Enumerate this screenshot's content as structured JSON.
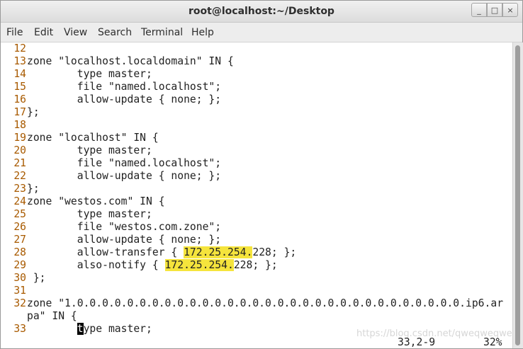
{
  "window": {
    "title": "root@localhost:~/Desktop"
  },
  "window_controls": [
    "_",
    "□",
    "×"
  ],
  "menu": [
    "File",
    "Edit",
    "View",
    "Search",
    "Terminal",
    "Help"
  ],
  "lines": [
    {
      "num": "12",
      "parts": []
    },
    {
      "num": "13",
      "parts": [
        {
          "t": "zone \"localhost.localdomain\" IN {"
        }
      ]
    },
    {
      "num": "14",
      "parts": [
        {
          "t": "        type master;"
        }
      ]
    },
    {
      "num": "15",
      "parts": [
        {
          "t": "        file \"named.localhost\";"
        }
      ]
    },
    {
      "num": "16",
      "parts": [
        {
          "t": "        allow-update { none; };"
        }
      ]
    },
    {
      "num": "17",
      "parts": [
        {
          "t": "};"
        }
      ]
    },
    {
      "num": "18",
      "parts": []
    },
    {
      "num": "19",
      "parts": [
        {
          "t": "zone \"localhost\" IN {"
        }
      ]
    },
    {
      "num": "20",
      "parts": [
        {
          "t": "        type master;"
        }
      ]
    },
    {
      "num": "21",
      "parts": [
        {
          "t": "        file \"named.localhost\";"
        }
      ]
    },
    {
      "num": "22",
      "parts": [
        {
          "t": "        allow-update { none; };"
        }
      ]
    },
    {
      "num": "23",
      "parts": [
        {
          "t": "};"
        }
      ]
    },
    {
      "num": "24",
      "parts": [
        {
          "t": "zone \"westos.com\" IN {"
        }
      ]
    },
    {
      "num": "25",
      "parts": [
        {
          "t": "        type master;"
        }
      ]
    },
    {
      "num": "26",
      "parts": [
        {
          "t": "        file \"westos.com.zone\";"
        }
      ]
    },
    {
      "num": "27",
      "parts": [
        {
          "t": "        allow-update { none; };"
        }
      ]
    },
    {
      "num": "28",
      "parts": [
        {
          "t": "        allow-transfer { "
        },
        {
          "t": "172.25.254.",
          "hl": true
        },
        {
          "t": "228; };"
        }
      ]
    },
    {
      "num": "29",
      "parts": [
        {
          "t": "        also-notify { "
        },
        {
          "t": "172.25.254.",
          "hl": true
        },
        {
          "t": "228; };"
        }
      ]
    },
    {
      "num": "30",
      "parts": [
        {
          "t": " };"
        }
      ]
    },
    {
      "num": "31",
      "parts": []
    },
    {
      "num": "32",
      "parts": [
        {
          "t": "zone \"1.0.0.0.0.0.0.0.0.0.0.0.0.0.0.0.0.0.0.0.0.0.0.0.0.0.0.0.0.0.0.0.ip6.ar"
        }
      ]
    },
    {
      "num": "",
      "parts": [
        {
          "t": "pa\" IN {"
        }
      ]
    },
    {
      "num": "33",
      "parts": [
        {
          "t": "        "
        },
        {
          "t": "t",
          "cursor": true
        },
        {
          "t": "ype master;"
        }
      ]
    }
  ],
  "status": {
    "position": "33,2-9",
    "percent": "32%"
  },
  "watermark": "https://blog.csdn.net/qweqweqwe"
}
